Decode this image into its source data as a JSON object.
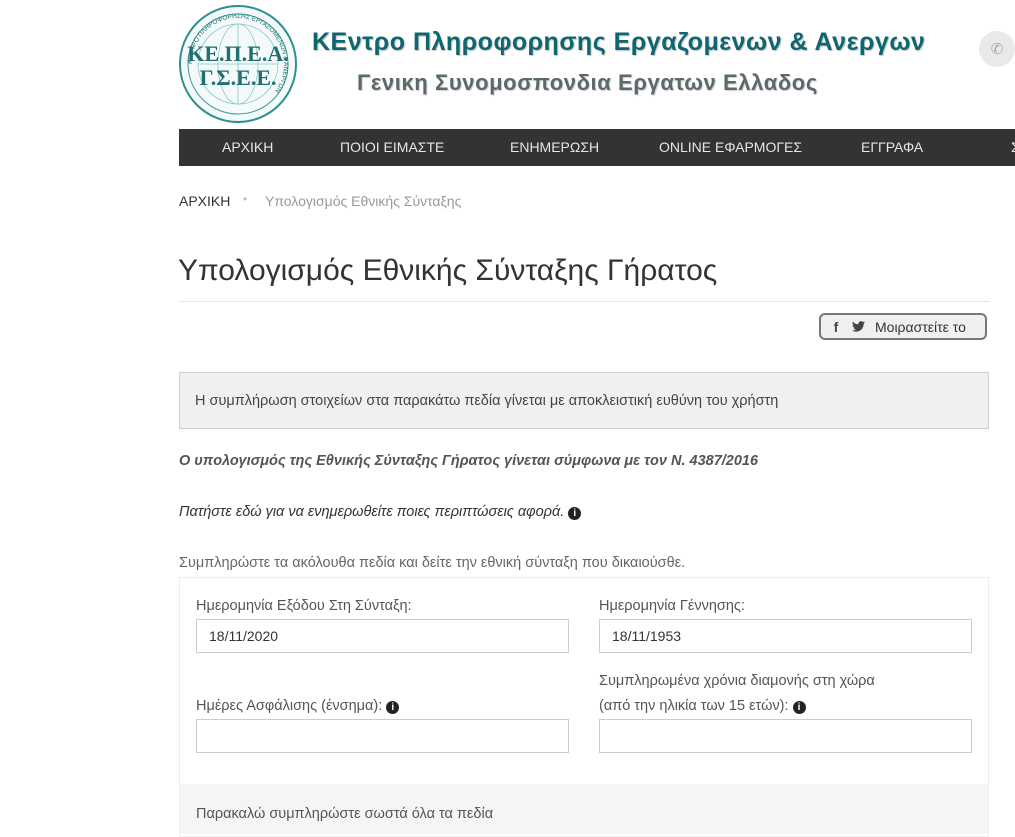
{
  "header": {
    "logo_line1": "ΚΕ.Π.Ε.Α.",
    "logo_line2": "Γ.Σ.Ε.Ε.",
    "logo_ring_text": "ΚΕΝΤΡΟ ΠΛΗΡΟΦΟΡΗΣΗΣ ΕΡΓΑΖΟΜΕΝΩΝ & ΑΝΕΡΓΩΝ",
    "title": "ΚΕντρο Πληροφορησης Εργαζομενων & Ανεργων",
    "subtitle": "Γενικη Συνομοσπονδια Εργατων Ελλαδος",
    "phone_icon": "phone-icon"
  },
  "nav": {
    "items": [
      "ΑΡΧΙΚΗ",
      "ΠΟΙΟΙ ΕΙΜΑΣΤΕ",
      "ΕΝΗΜΕΡΩΣΗ",
      "ONLINE ΕΦΑΡΜΟΓΕΣ",
      "ΕΓΓΡΑΦΑ",
      "Σ"
    ]
  },
  "breadcrumb": {
    "home": "ΑΡΧΙΚΗ",
    "separator": "•",
    "current": "Υπολογισμός Εθνικής Σύνταξης"
  },
  "page": {
    "title": "Υπολογισμός Εθνικής Σύνταξης Γήρατος",
    "share_label": "Μοιραστείτε το",
    "share_icons": [
      "facebook-icon",
      "twitter-icon"
    ],
    "notice": "Η συμπλήρωση στοιχείων στα παρακάτω πεδία γίνεται με αποκλειστική ευθύνη του χρήστη",
    "law_line": "Ο υπολογισμός της Εθνικής Σύνταξης Γήρατος γίνεται σύμφωνα με τον Ν. 4387/2016",
    "info_line": "Πατήστε εδώ για να ενημερωθείτε ποιες περιπτώσεις αφορά.",
    "fill_line": "Συμπληρώστε τα ακόλουθα πεδία και δείτε την εθνική σύνταξη που δικαιούσθε."
  },
  "form": {
    "exit_date_label": "Ημερομηνία Εξόδου Στη Σύνταξη:",
    "exit_date_value": "18/11/2020",
    "birth_date_label": "Ημερομηνία Γέννησης:",
    "birth_date_value": "18/11/1953",
    "insurance_days_label": "Ημέρες Ασφάλισης (ένσημα):",
    "insurance_days_value": "",
    "residence_label_line1": "Συμπληρωμένα χρόνια διαμονής στη χώρα",
    "residence_label_line2": "(από την ηλικία των 15 ετών):",
    "residence_value": "",
    "footer_message": "Παρακαλώ συμπληρώστε σωστά όλα τα πεδία"
  }
}
